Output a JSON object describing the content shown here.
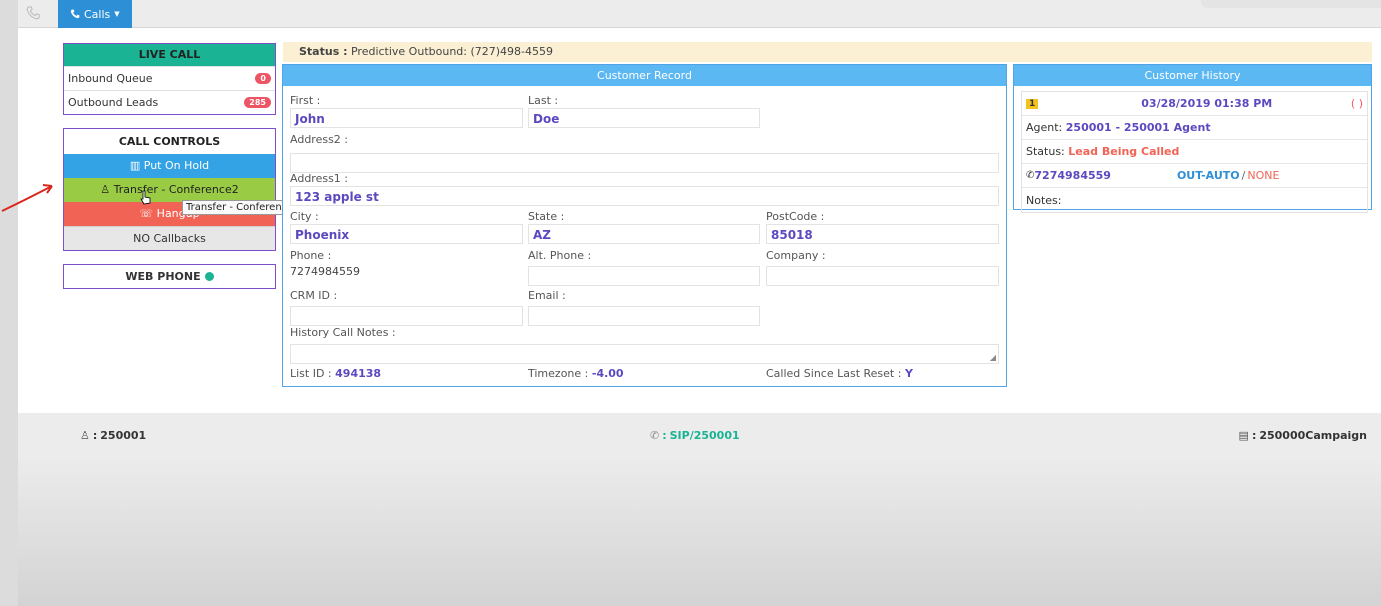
{
  "topbar": {
    "calls_label": "Calls"
  },
  "live_call": {
    "title": "LIVE CALL",
    "items": [
      {
        "label": "Inbound Queue",
        "count": "0"
      },
      {
        "label": "Outbound Leads",
        "count": "285"
      }
    ]
  },
  "call_controls": {
    "title": "CALL CONTROLS",
    "hold": "Put On Hold",
    "transfer": "Transfer - Conference2",
    "hangup": "Hangup",
    "callbacks": "NO Callbacks"
  },
  "tooltip": "Transfer - Conference",
  "web_phone": {
    "label": "WEB PHONE"
  },
  "status": {
    "label": "Status :",
    "value": "Predictive Outbound: (727)498-4559"
  },
  "record": {
    "title": "Customer Record",
    "first": {
      "label": "First :",
      "value": "John"
    },
    "last": {
      "label": "Last :",
      "value": "Doe"
    },
    "address2": {
      "label": "Address2 :",
      "value": ""
    },
    "address1": {
      "label": "Address1 :",
      "value": "123 apple st"
    },
    "city": {
      "label": "City :",
      "value": "Phoenix"
    },
    "state": {
      "label": "State :",
      "value": "AZ"
    },
    "postcode": {
      "label": "PostCode :",
      "value": "85018"
    },
    "phone": {
      "label": "Phone :",
      "value": "7274984559"
    },
    "alt_phone": {
      "label": "Alt. Phone :",
      "value": ""
    },
    "company": {
      "label": "Company :",
      "value": ""
    },
    "crm_id": {
      "label": "CRM ID :",
      "value": ""
    },
    "email": {
      "label": "Email :",
      "value": ""
    },
    "history_notes": {
      "label": "History Call Notes :",
      "value": ""
    },
    "list_id": {
      "label": "List ID :",
      "value": "494138"
    },
    "timezone": {
      "label": "Timezone :",
      "value": "-4.00"
    },
    "called_since": {
      "label": "Called Since Last Reset :",
      "value": "Y"
    }
  },
  "history": {
    "title": "Customer History",
    "number": "1",
    "datetime": "03/28/2019 01:38 PM",
    "paren": "( )",
    "agent_label": "Agent:",
    "agent_value": "250001 - 250001 Agent",
    "status_label": "Status:",
    "status_value": "Lead Being Called",
    "phone": "7274984559",
    "call_type": "OUT-AUTO",
    "separator": "/",
    "call_result": "NONE",
    "notes_label": "Notes:"
  },
  "footer": {
    "user": "250001",
    "sip": "SIP/250001",
    "campaign": "250000Campaign",
    "sep": ":"
  },
  "colors": {
    "accent_blue": "#2d8fd5",
    "live_green": "#1ab394",
    "transfer_green": "#99cc44",
    "hangup_red": "#f16354",
    "purple_value": "#5b4abf"
  }
}
